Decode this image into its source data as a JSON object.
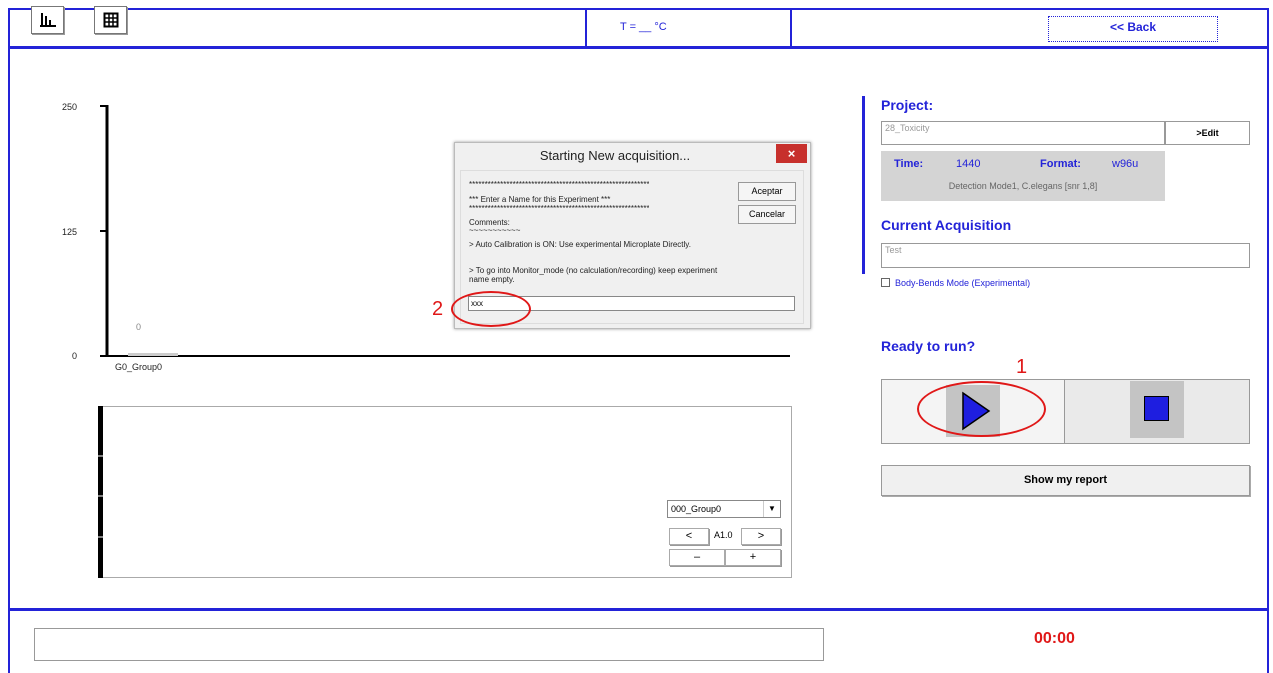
{
  "toolbar": {
    "temperature_label": "T = __ °C",
    "back_label": "<< Back",
    "icons": [
      "bar-chart-icon",
      "grid-icon"
    ]
  },
  "chart_data": {
    "type": "bar",
    "categories": [
      "G0_Group0"
    ],
    "values": [
      0
    ],
    "data_labels": [
      "0"
    ],
    "yticks": [
      "250",
      "125",
      "0"
    ],
    "ylim": [
      0,
      250
    ]
  },
  "lower_panel": {
    "group_select_value": "000_Group0",
    "prev_label": "<",
    "next_label": ">",
    "well_label": "A1.0",
    "minus_label": "–",
    "plus_label": "+"
  },
  "dialog": {
    "title": "Starting New acquisition...",
    "close_label": "×",
    "separator_line": "*************************************************************",
    "prompt": "***  Enter a Name for this Experiment  ***",
    "comments_label": "Comments:",
    "tilde_line": "~~~~~~~~~~~",
    "note_1": "> Auto Calibration is ON: Use experimental Microplate Directly.",
    "note_2": "> To go into Monitor_mode (no calculation/recording) keep experiment name empty.",
    "accept_label": "Aceptar",
    "cancel_label": "Cancelar",
    "input_value": "xxx"
  },
  "annotations": {
    "marker_1": "1",
    "marker_2": "2",
    "color": "#e01818"
  },
  "right_panel": {
    "project_heading": "Project:",
    "project_value": "28_Toxicity",
    "edit_label": ">Edit",
    "time_label": "Time:",
    "time_value": "1440",
    "format_label": "Format:",
    "format_value": "w96u",
    "detection_text": "Detection Mode1, C.elegans [snr 1,8]",
    "acquisition_heading": "Current Acquisition",
    "acquisition_value": "Test",
    "bodybends_label": "Body-Bends Mode (Experimental)",
    "ready_label": "Ready to run?",
    "report_label": "Show my report"
  },
  "bottom": {
    "timer": "00:00"
  },
  "colors": {
    "accent": "#2323d8",
    "alert": "#e01818"
  }
}
